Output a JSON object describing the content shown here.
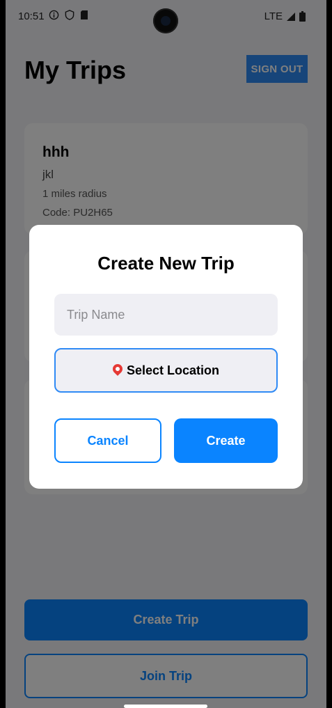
{
  "status_bar": {
    "time": "10:51",
    "network": "LTE"
  },
  "header": {
    "title": "My Trips",
    "sign_out_label": "SIGN OUT"
  },
  "trips": [
    {
      "name": "hhh",
      "description": "jkl",
      "radius": "1 miles radius",
      "code": "Code: PU2H65"
    }
  ],
  "bottom": {
    "create_trip_label": "Create Trip",
    "join_trip_label": "Join Trip"
  },
  "modal": {
    "title": "Create New Trip",
    "trip_name_placeholder": "Trip Name",
    "trip_name_value": "",
    "select_location_label": "Select Location",
    "cancel_label": "Cancel",
    "create_label": "Create"
  },
  "colors": {
    "accent": "#0a84ff",
    "overlay": "rgba(0,0,0,0.5)",
    "pin": "#e53935"
  }
}
